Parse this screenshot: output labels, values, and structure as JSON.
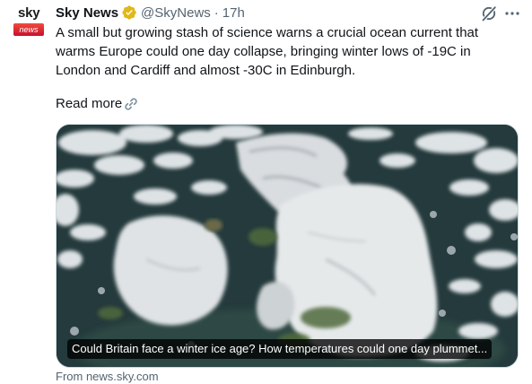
{
  "tweet": {
    "author_name": "Sky News",
    "handle": "@SkyNews",
    "separator": "·",
    "time": "17h",
    "text": "A small but growing stash of science warns a crucial ocean current that warms Europe could one day collapse, bringing winter lows of -19C in London and Cardiff and almost -30C in Edinburgh.",
    "read_more": "Read more",
    "avatar": {
      "logo_text": "sky",
      "logo_subtext": "news"
    },
    "card": {
      "caption": "Could Britain face a winter ice age? How temperatures could one day plummet...",
      "source": "From news.sky.com",
      "image_semantic": "satellite-image-snow-covered-britain"
    }
  },
  "icons": {
    "verified": "verified-badge-icon",
    "grok": "grok-icon",
    "more": "more-icon",
    "link": "link-icon"
  },
  "colors": {
    "text_primary": "#0f1419",
    "text_secondary": "#536471",
    "verified_gold": "#e2b719",
    "sky_red": "#c8102e"
  }
}
